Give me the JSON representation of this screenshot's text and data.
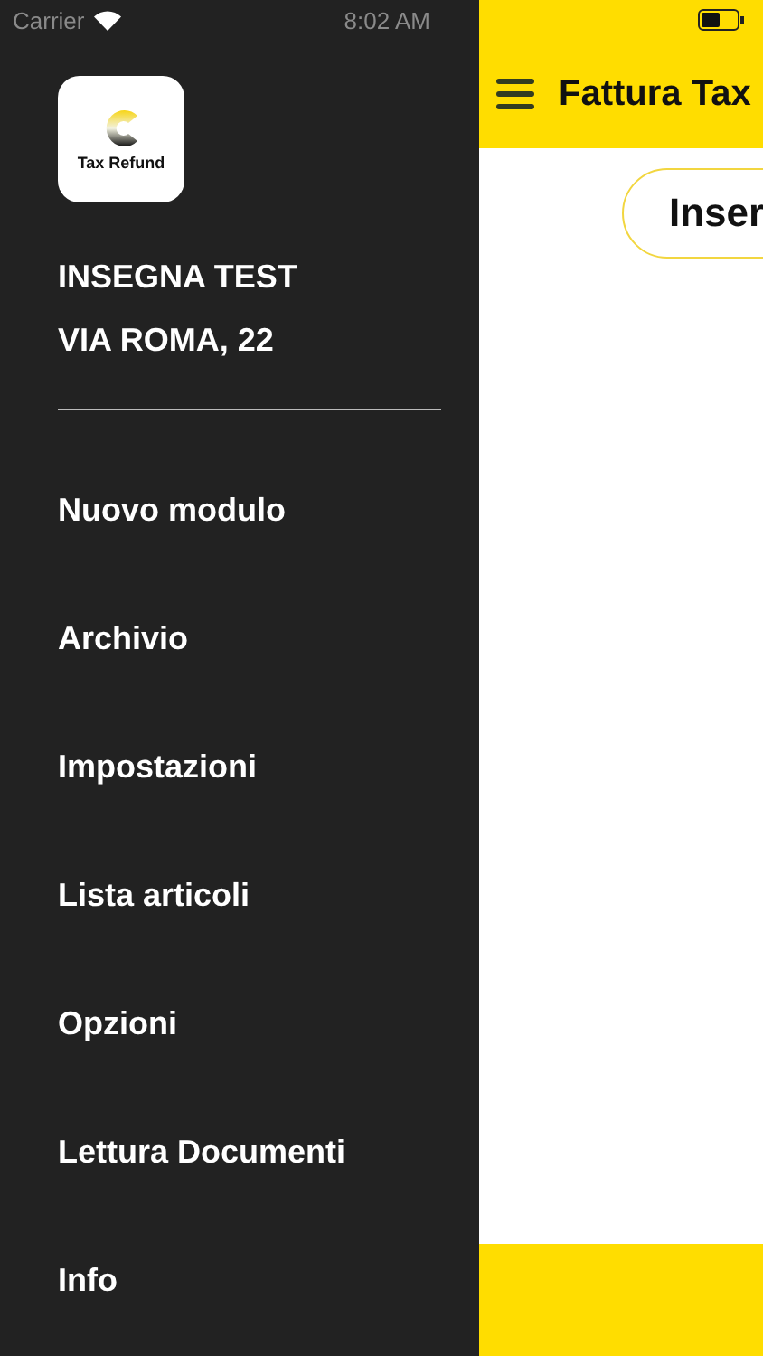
{
  "status_bar": {
    "carrier": "Carrier",
    "time": "8:02 AM"
  },
  "drawer": {
    "logo": {
      "caption": "Tax Refund"
    },
    "shop_name": "INSEGNA TEST",
    "address": "VIA ROMA, 22",
    "items": [
      {
        "label": "Nuovo modulo"
      },
      {
        "label": "Archivio"
      },
      {
        "label": "Impostazioni"
      },
      {
        "label": "Lista articoli"
      },
      {
        "label": "Opzioni"
      },
      {
        "label": "Lettura Documenti"
      },
      {
        "label": "Info"
      }
    ]
  },
  "header": {
    "title": "Fattura Tax"
  },
  "content": {
    "button": "Inser"
  }
}
